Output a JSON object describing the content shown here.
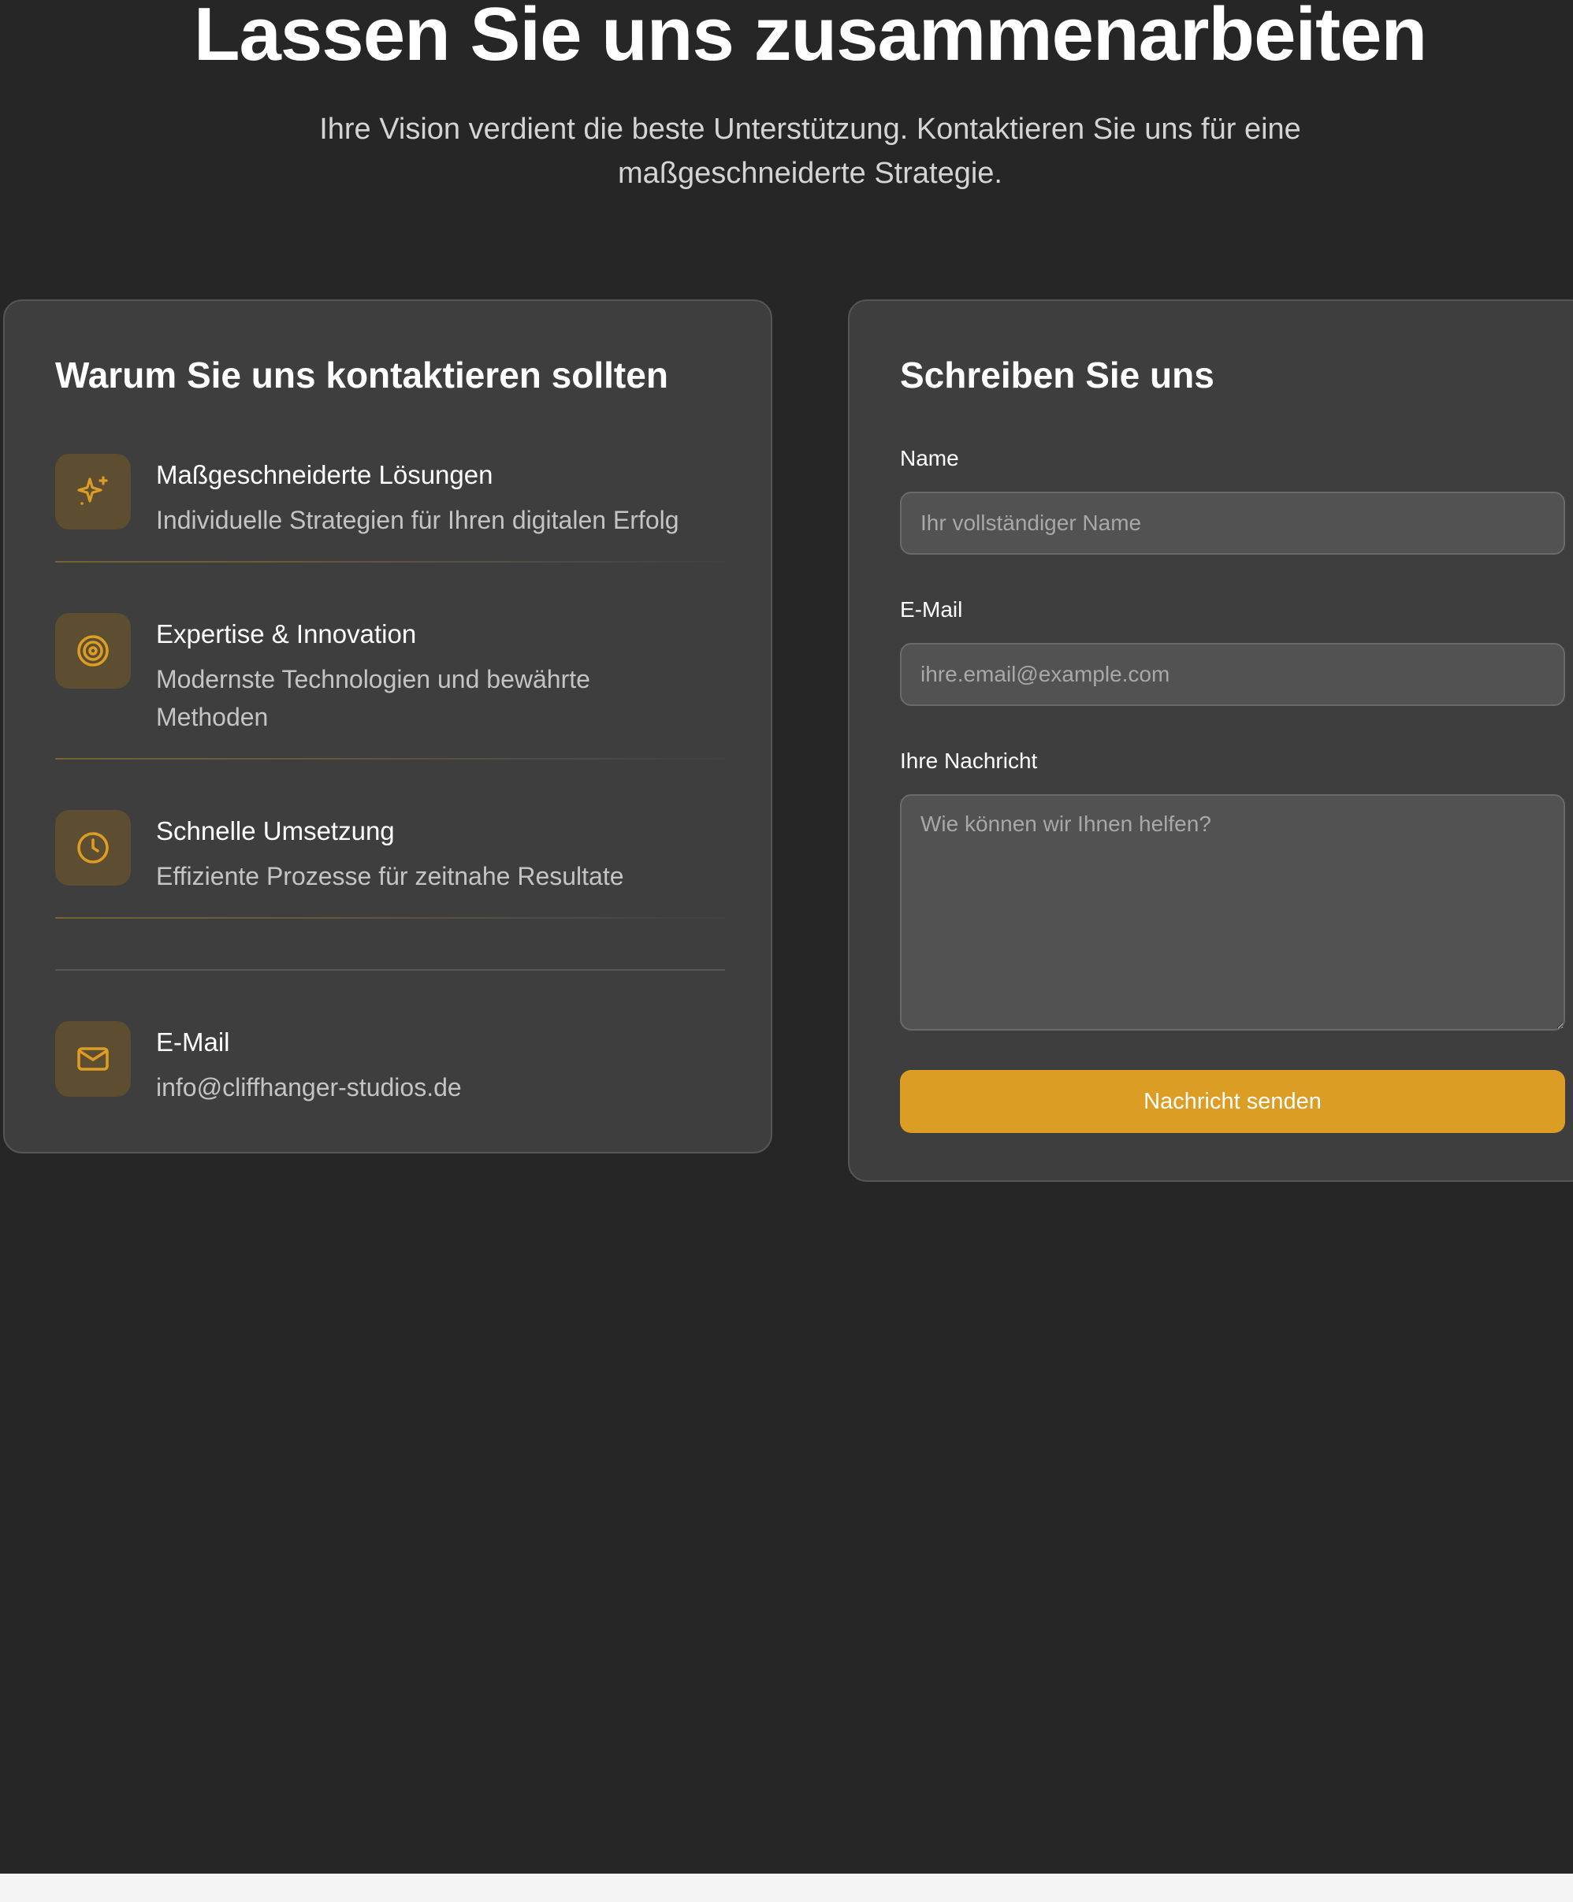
{
  "hero": {
    "title": "Lassen Sie uns zusammenarbeiten",
    "subtitle": "Ihre Vision verdient die beste Unterstützung. Kontaktieren Sie uns für eine maßgeschneiderte Strategie."
  },
  "why_card": {
    "title": "Warum Sie uns kontaktieren sollten",
    "features": [
      {
        "icon": "sparkles-icon",
        "title": "Maßgeschneiderte Lösungen",
        "description": "Individuelle Strategien für Ihren digitalen Erfolg"
      },
      {
        "icon": "target-icon",
        "title": "Expertise & Innovation",
        "description": "Modernste Technologien und bewährte Methoden"
      },
      {
        "icon": "clock-icon",
        "title": "Schnelle Umsetzung",
        "description": "Effiziente Prozesse für zeitnahe Resultate"
      }
    ],
    "contact": {
      "icon": "mail-icon",
      "label": "E-Mail",
      "value": "info@cliffhanger-studios.de"
    }
  },
  "form_card": {
    "title": "Schreiben Sie uns",
    "name": {
      "label": "Name",
      "placeholder": "Ihr vollständiger Name",
      "value": ""
    },
    "email": {
      "label": "E-Mail",
      "placeholder": "ihre.email@example.com",
      "value": ""
    },
    "message": {
      "label": "Ihre Nachricht",
      "placeholder": "Wie können wir Ihnen helfen?",
      "value": ""
    },
    "submit_label": "Nachricht senden"
  },
  "colors": {
    "page_background": "#262626",
    "card_background": "#3e3e3e",
    "accent": "#dc9d24",
    "icon_tile": "#5e4e31"
  }
}
